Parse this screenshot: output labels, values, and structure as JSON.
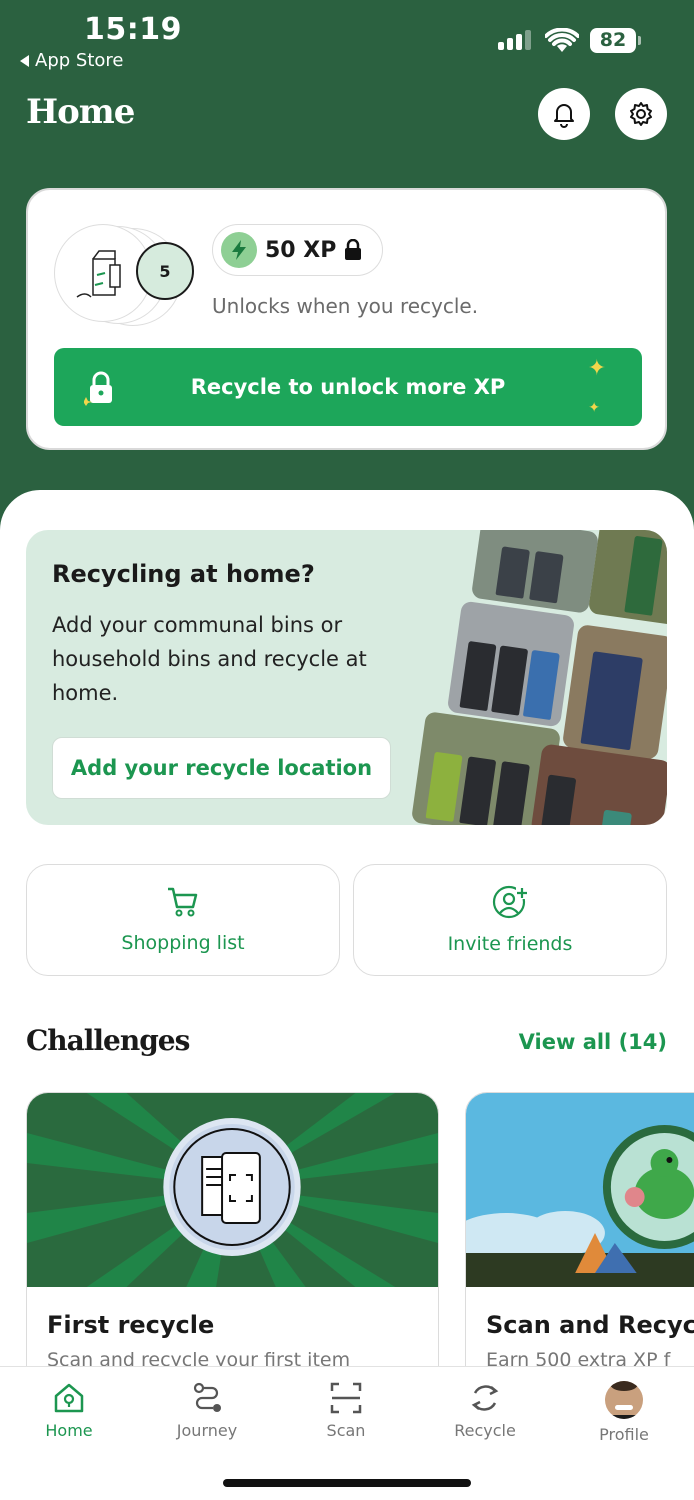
{
  "status_bar": {
    "time": "15:19",
    "back_app": "App Store",
    "battery": "82"
  },
  "header": {
    "title": "Home",
    "icons": [
      "bell-icon",
      "gear-icon"
    ]
  },
  "xp_card": {
    "badge_count": "5",
    "xp_value": "50 XP",
    "unlock_text": "Unlocks when you recycle.",
    "button_label": "Recycle to unlock more XP"
  },
  "promo": {
    "title": "Recycling at home?",
    "body": "Add your communal bins or household bins and recycle at home.",
    "button_label": "Add your recycle location"
  },
  "quick_actions": [
    {
      "label": "Shopping list",
      "icon": "cart-icon"
    },
    {
      "label": "Invite friends",
      "icon": "add-user-icon"
    }
  ],
  "challenges": {
    "title": "Challenges",
    "view_all": "View all (14)",
    "cards": [
      {
        "title": "First recycle",
        "description": "Scan and recycle your first item"
      },
      {
        "title": "Scan and Recycle",
        "description": "Earn 500 extra XP f"
      }
    ]
  },
  "tabs": [
    {
      "label": "Home",
      "icon": "home-icon",
      "active": true
    },
    {
      "label": "Journey",
      "icon": "route-icon",
      "active": false
    },
    {
      "label": "Scan",
      "icon": "scan-icon",
      "active": false
    },
    {
      "label": "Recycle",
      "icon": "recycle-icon",
      "active": false
    },
    {
      "label": "Profile",
      "icon": "avatar",
      "active": false
    }
  ],
  "colors": {
    "header_green": "#2b6140",
    "accent_green": "#1da65a",
    "text_green": "#1c9650",
    "promo_bg": "#d8ebe0"
  }
}
